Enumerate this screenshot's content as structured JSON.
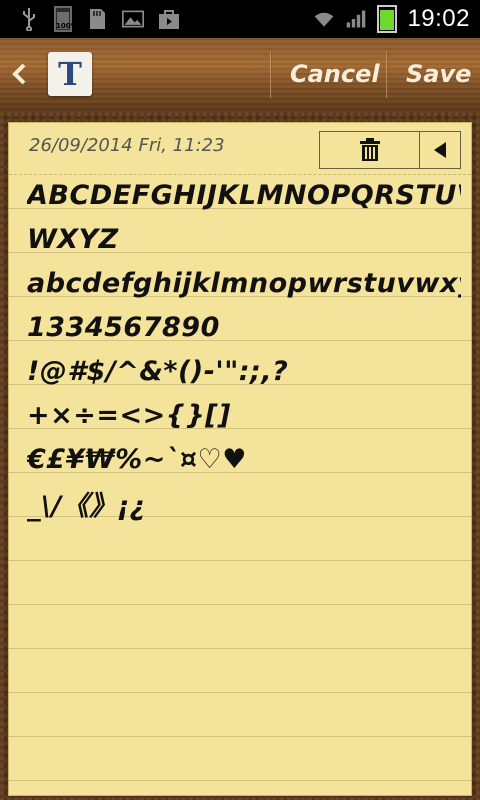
{
  "status_bar": {
    "icons_left": [
      "usb-icon",
      "battery-saver-icon",
      "sd-card-icon",
      "gallery-icon",
      "store-icon"
    ],
    "battery_small_label": "100%",
    "icons_right": [
      "wifi-icon",
      "signal-icon",
      "battery-icon"
    ],
    "time": "19:02"
  },
  "header": {
    "back_icon": "chevron-left-icon",
    "app_letter": "T",
    "cancel_label": "Cancel",
    "save_label": "Save"
  },
  "note": {
    "date": "26/09/2014 Fri, 11:23",
    "delete_icon": "trash-icon",
    "prev_icon": "triangle-left-icon",
    "lines": [
      "ABCDEFGHIJKLMNOPQRSTUV",
      "WXYZ",
      "abcdefghijklmnopwrstuvwxyz",
      "1334567890",
      "!@#$/^&*()-'\":;,?",
      "+×÷=<>{}[]",
      "€£¥₩%~`¤♡♥",
      "_\\/《》¡¿",
      "",
      "",
      "",
      "",
      "",
      ""
    ]
  },
  "colors": {
    "paper": "#f4e39a",
    "wood": "#a46a32",
    "battery_green": "#6fd82b"
  }
}
